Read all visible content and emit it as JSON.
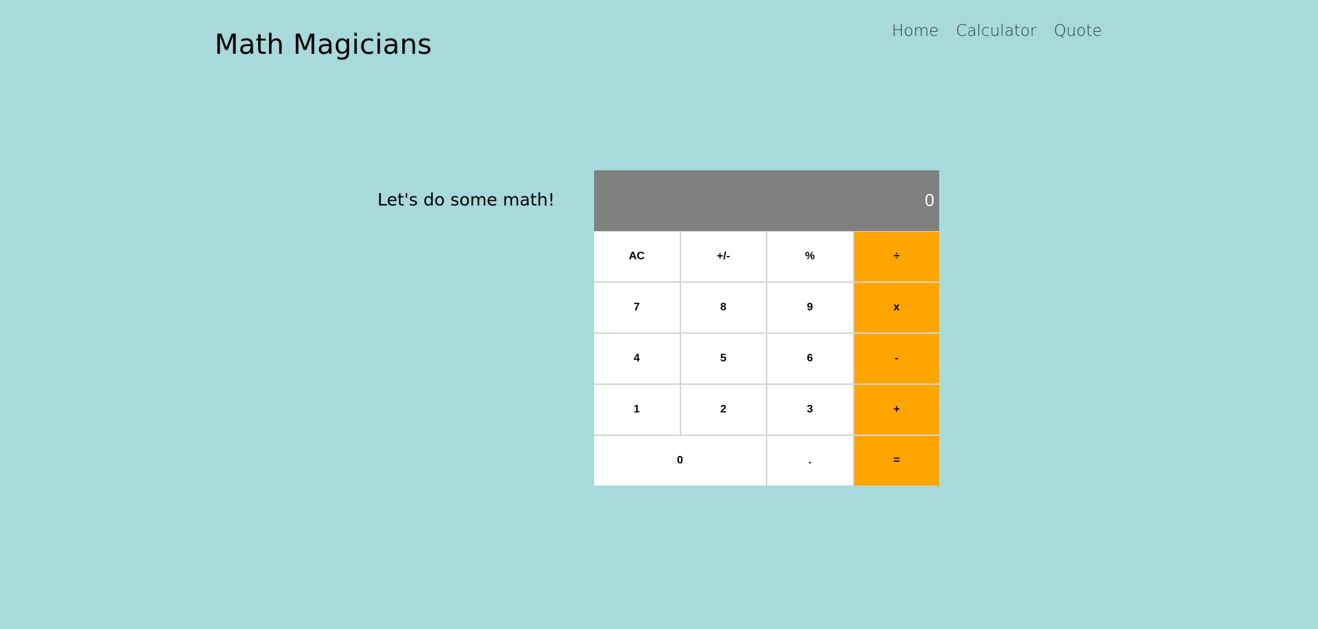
{
  "header": {
    "brand": "Math Magicians",
    "nav": [
      "Home",
      "Calculator",
      "Quote"
    ]
  },
  "main": {
    "intro": "Let's do some math!"
  },
  "calculator": {
    "display": "0",
    "keys": {
      "ac": "AC",
      "sign": "+/-",
      "percent": "%",
      "divide": "÷",
      "seven": "7",
      "eight": "8",
      "nine": "9",
      "multiply": "x",
      "four": "4",
      "five": "5",
      "six": "6",
      "subtract": "-",
      "one": "1",
      "two": "2",
      "three": "3",
      "add": "+",
      "zero": "0",
      "decimal": ".",
      "equals": "="
    }
  },
  "colors": {
    "background": "#a8d9db",
    "display": "#808080",
    "operator": "#ffa500",
    "key": "#ffffff"
  }
}
